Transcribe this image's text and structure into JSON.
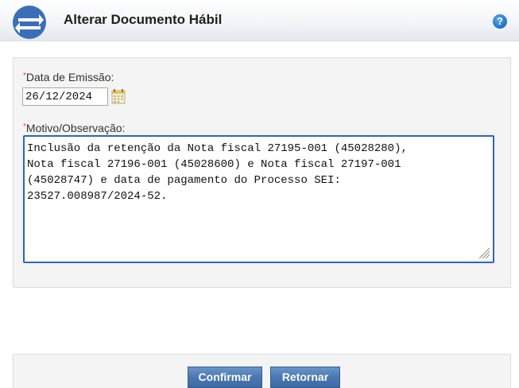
{
  "header": {
    "title": "Alterar Documento Hábil",
    "help_glyph": "?",
    "logo_icon": "logo-icon",
    "colors": {
      "logo_blue": "#3a6fb8",
      "help_blue": "#1f6fc9"
    }
  },
  "form": {
    "date": {
      "required_mark": "*",
      "label": "Data de Emissão:",
      "value": "26/12/2024",
      "icon": "calendar-icon"
    },
    "motivo": {
      "required_mark": "*",
      "label": "Motivo/Observação:",
      "value": "Inclusão da retenção da Nota fiscal 27195-001 (45028280),\nNota fiscal 27196-001 (45028600) e Nota fiscal 27197-001\n(45028747) e data de pagamento do Processo SEI:\n23527.008987/2024-52."
    }
  },
  "actions": {
    "confirm_label": "Confirmar",
    "back_label": "Retornar",
    "button_color": "#4a78b3"
  }
}
